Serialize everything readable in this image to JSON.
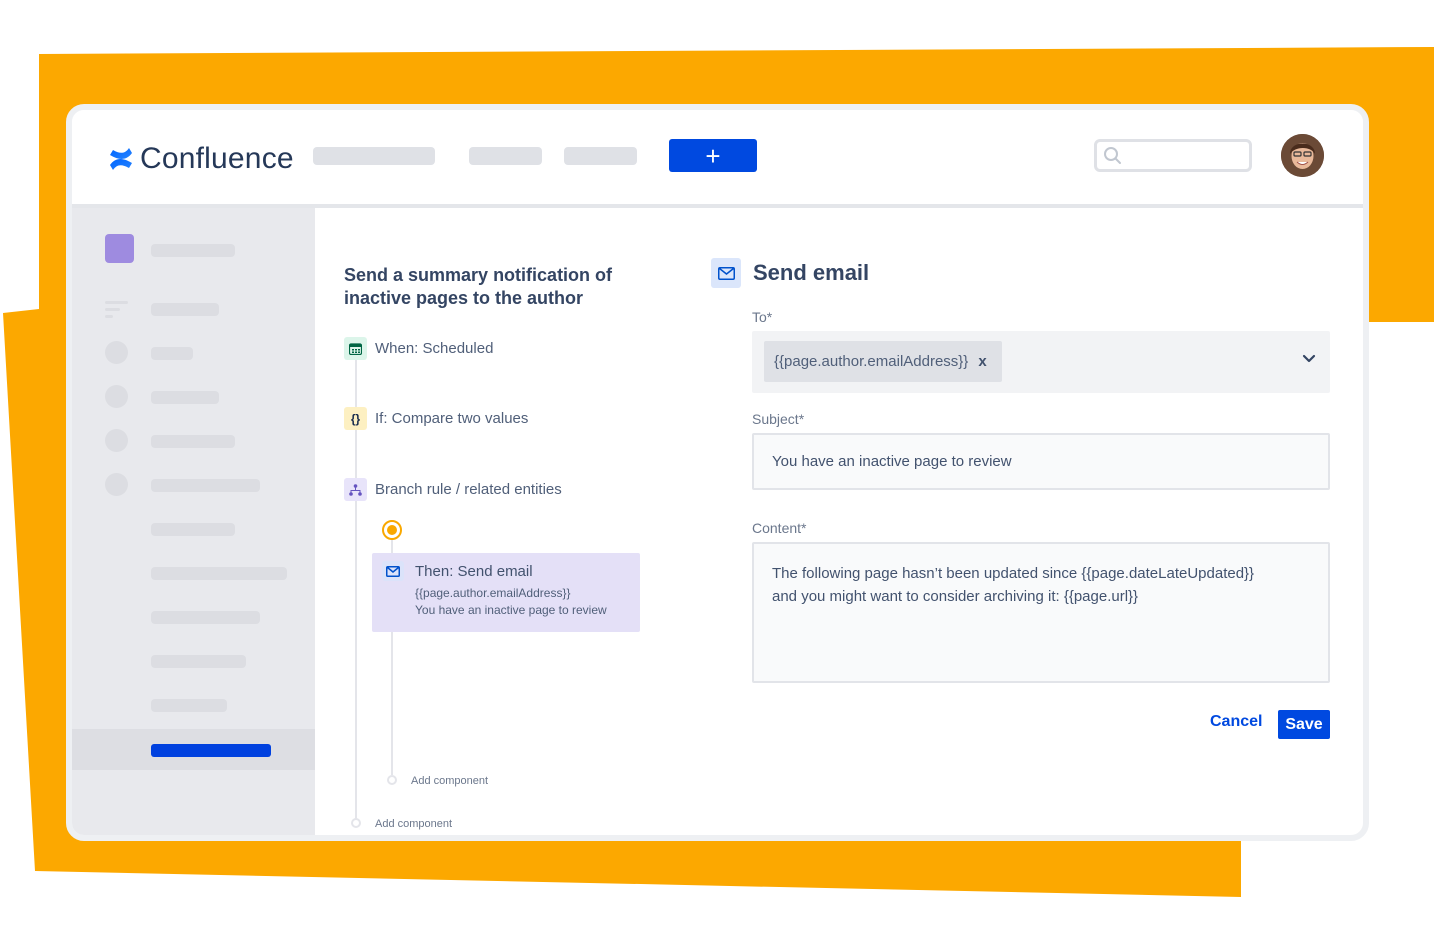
{
  "colors": {
    "backdrop_orange": "#fca800",
    "primary_blue": "#0049e0",
    "sidebar_bg": "#e8e9ed",
    "space_avatar": "#9e8be0",
    "when_bg": "#dcf5ea",
    "if_bg": "#fdf0c2",
    "branch_bg": "#e8e4fa",
    "then_card_bg": "#e4e0f7",
    "node_orange": "#f9a800"
  },
  "header": {
    "app_name": "Confluence",
    "logo_icon": "confluence-logo-icon",
    "create_button_label": "+",
    "search_icon": "search-icon",
    "search_placeholder": "",
    "avatar_icon": "user-avatar"
  },
  "rule": {
    "title": "Send a summary notification of inactive pages to the author",
    "steps": [
      {
        "icon": "calendar-icon",
        "label": "When: Scheduled"
      },
      {
        "icon": "braces-icon",
        "glyph": "{}",
        "label": "If: Compare two values"
      },
      {
        "icon": "branch-icon",
        "label": "Branch rule / related entities"
      }
    ],
    "then_card": {
      "icon": "mail-icon",
      "title": "Then: Send email",
      "line1": "{{page.author.emailAddress}}",
      "line2": "You have an inactive page to review"
    },
    "add_component_inner": "Add component",
    "add_component_outer": "Add component"
  },
  "form": {
    "icon": "mail-icon",
    "title": "Send email",
    "to_label": "To*",
    "to_chip": "{{page.author.emailAddress}}",
    "to_chip_remove": "x",
    "subject_label": "Subject*",
    "subject_value": "You have an inactive page to review",
    "content_label": "Content*",
    "content_line1": "The following page hasn’t been updated since {{page.dateLateUpdated}}",
    "content_line2": "and you might want to consider archiving it: {{page.url}}",
    "cancel_label": "Cancel",
    "save_label": "Save"
  }
}
